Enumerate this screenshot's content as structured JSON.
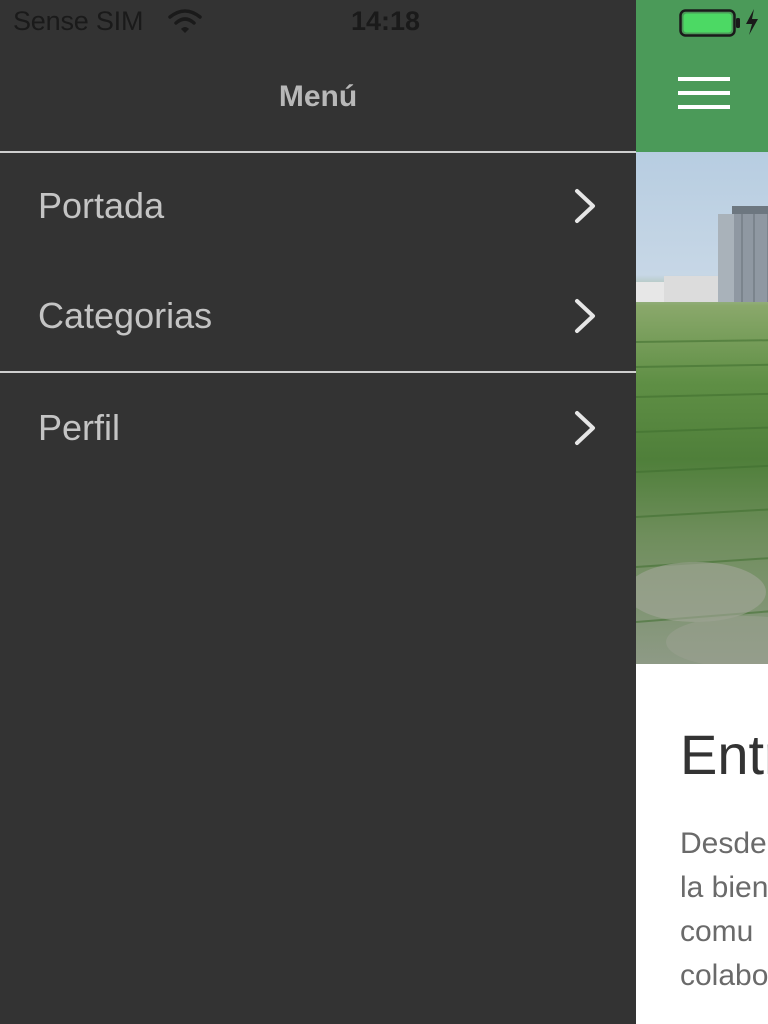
{
  "status_bar": {
    "carrier": "Sense SIM",
    "time": "14:18",
    "wifi_icon": "wifi-icon",
    "battery_icon": "battery-icon",
    "charging_icon": "charging-bolt-icon",
    "battery_level": 1.0,
    "battery_color": "#4cd964"
  },
  "side_menu": {
    "title": "Menú",
    "items": [
      {
        "label": "Portada",
        "icon": "chevron-right-icon"
      },
      {
        "label": "Categorias",
        "icon": "chevron-right-icon"
      },
      {
        "label": "Perfil",
        "icon": "chevron-right-icon"
      }
    ],
    "background": "#333333"
  },
  "content_page": {
    "header_color": "#4b9a59",
    "menu_icon": "hamburger-menu-icon",
    "hero_image": "rice-field-with-silos-photo",
    "article_title": "Entr",
    "article_body_lines": [
      "Desde",
      "la bien",
      "comu",
      "colabo"
    ]
  }
}
